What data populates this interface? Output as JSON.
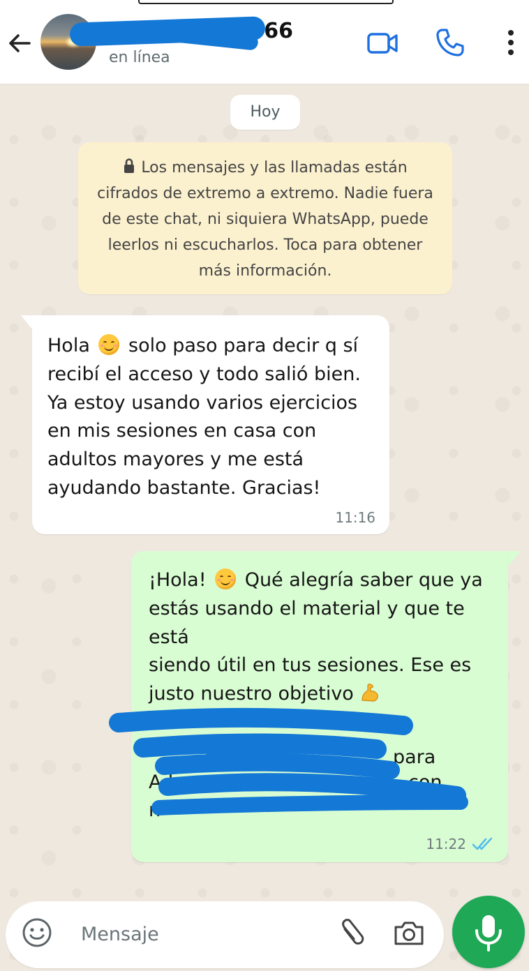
{
  "header": {
    "contact_name": "66",
    "status": "en línea"
  },
  "chat": {
    "date_chip": "Hoy",
    "encryption_notice": "Los mensajes y las llamadas están cifrados de extremo a extremo. Nadie fuera de este chat, ni siquiera WhatsApp, puede leerlos ni escucharlos. Toca para obtener más información.",
    "incoming": {
      "part1": "Hola ",
      "part2": " solo paso para decir q sí\nrecibí el acceso y todo salió bien.\nYa estoy usando varios ejercicios\nen mis sesiones en casa con\nadultos mayores y me está\nayudando bastante. Gracias!",
      "time": "11:16"
    },
    "outgoing": {
      "part1": "¡Hola! ",
      "part2": " Qué alegría saber que ya\nestás usando el material y que te está\nsiendo útil en tus sesiones. Ese es\njusto nuestro objetivo ",
      "line_partial_1": "para",
      "line_partial_2": "Ad",
      "line_partial_3": "con",
      "line_partial_4": "n",
      "time": "11:22",
      "read_status": "read"
    }
  },
  "composer": {
    "placeholder": "Mensaje"
  },
  "colors": {
    "accent_blue": "#1478d6",
    "header_icons": "#1e6fe0",
    "outgoing_bubble": "#d9fdd3",
    "incoming_bubble": "#ffffff",
    "mic_button": "#1fa855",
    "read_ticks": "#53bdeb"
  },
  "icons": [
    "back-arrow-icon",
    "video-call-icon",
    "phone-icon",
    "more-vert-icon",
    "lock-icon",
    "smile-emoji",
    "flexed-biceps-emoji",
    "double-check-icon",
    "emoji-icon",
    "attach-icon",
    "camera-icon",
    "mic-icon"
  ]
}
